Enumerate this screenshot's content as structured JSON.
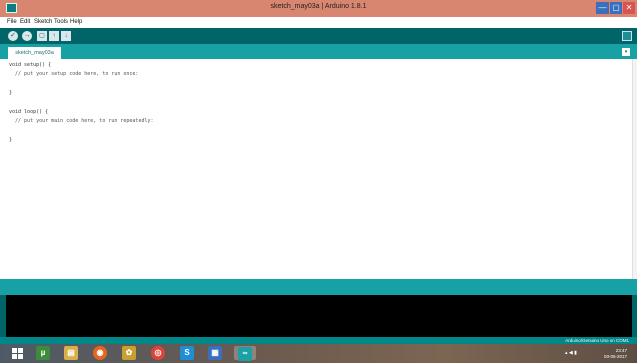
{
  "window": {
    "title": "sketch_may03a | Arduino 1.8.1",
    "controls": {
      "minimize": "—",
      "maximize": "▢",
      "close": "✕"
    }
  },
  "menu": [
    "File",
    "Edit",
    "Sketch",
    "Tools",
    "Help"
  ],
  "toolbar": {
    "verify": "✓",
    "upload": "→",
    "new": "▢",
    "open": "↑",
    "save": "↓"
  },
  "tabs": [
    {
      "label": "sketch_may03a"
    }
  ],
  "tab_menu": "▾",
  "editor": {
    "lines": [
      "void setup() {",
      "  // put your setup code here, to run once:",
      "",
      "}",
      "",
      "void loop() {",
      "  // put your main code here, to run repeatedly:",
      "",
      "}"
    ]
  },
  "status": {
    "board": "Arduino/Genuino Uno on COM1"
  },
  "taskbar": {
    "apps": [
      "uTorrent",
      "File Explorer",
      "Firefox",
      "Media",
      "Chrome",
      "Skype",
      "Notepad",
      "Arduino"
    ],
    "time": "23:47",
    "date": "03-05-2017"
  },
  "colors": {
    "titlebar": "#d98670",
    "toolbar": "#006468",
    "tabbar": "#17a1a5",
    "console": "#000000"
  }
}
